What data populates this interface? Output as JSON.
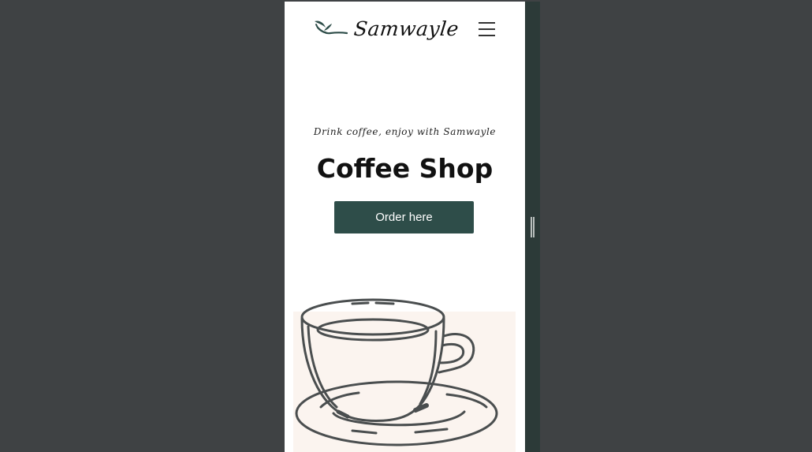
{
  "brand": {
    "name": "Samwayle",
    "icon": "leaf-branch-logo"
  },
  "header": {
    "menu_icon": "hamburger-menu-icon"
  },
  "hero": {
    "tagline": "Drink coffee, enjoy with Samwayle",
    "title": "Coffee Shop",
    "cta_label": "Order here",
    "image_icon": "coffee-cup-illustration"
  },
  "colors": {
    "accent": "#2e4d49",
    "page_background": "#3f4244",
    "image_background": "#fbf4ef",
    "resize_bar": "#2c3a38"
  }
}
